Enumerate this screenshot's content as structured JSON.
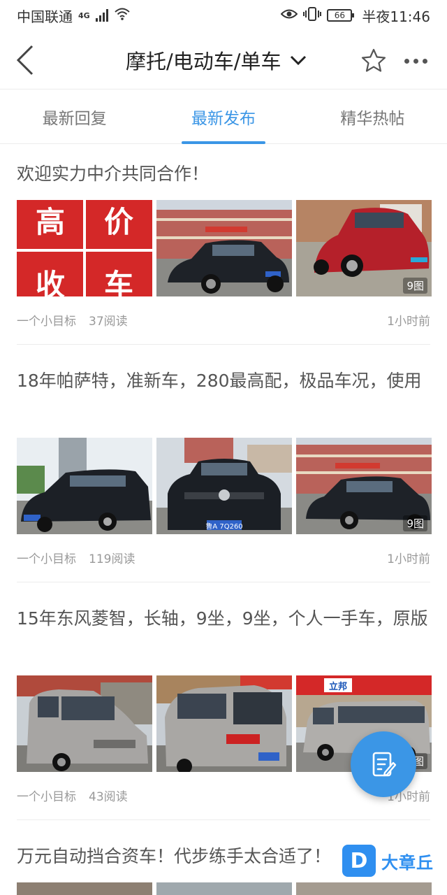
{
  "status_bar": {
    "carrier": "中国联通",
    "network": "4G",
    "battery": "66",
    "time": "半夜11:46"
  },
  "nav": {
    "title": "摩托/电动车/单车",
    "back_icon": "chevron-left-icon",
    "dropdown_icon": "chevron-down-icon",
    "favorite_icon": "star-outline-icon",
    "more_icon": "more-dots-icon"
  },
  "tabs": [
    {
      "label": "最新回复",
      "active": false
    },
    {
      "label": "最新发布",
      "active": true
    },
    {
      "label": "精华热帖",
      "active": false
    }
  ],
  "posts": [
    {
      "title": "欢迎实力中介共同合作！",
      "sign_text": [
        "高",
        "价",
        "收",
        "车"
      ],
      "picture_count": "9图",
      "author": "一个小目标",
      "reads": "37阅读",
      "time": "1小时前"
    },
    {
      "title": "18年帕萨特，准新车，280最高配，极品车况，使用",
      "plate": "鲁A 7Q260",
      "picture_count": "9图",
      "author": "一个小目标",
      "reads": "119阅读",
      "time": "1小时前"
    },
    {
      "title": "15年东风菱智，长轴，9坐，9坐，个人一手车，原版",
      "store_sign": "立邦",
      "picture_count": "9图",
      "author": "一个小目标",
      "reads": "43阅读",
      "time": "1小时前"
    },
    {
      "title": "万元自动挡合资车！代步练手太合适了！"
    }
  ],
  "fab": {
    "icon": "edit-post-icon"
  },
  "watermark": {
    "badge": "D",
    "text": "大章丘"
  },
  "colors": {
    "accent": "#3b96e6",
    "meta_text": "#999999",
    "title_text": "#555555"
  }
}
